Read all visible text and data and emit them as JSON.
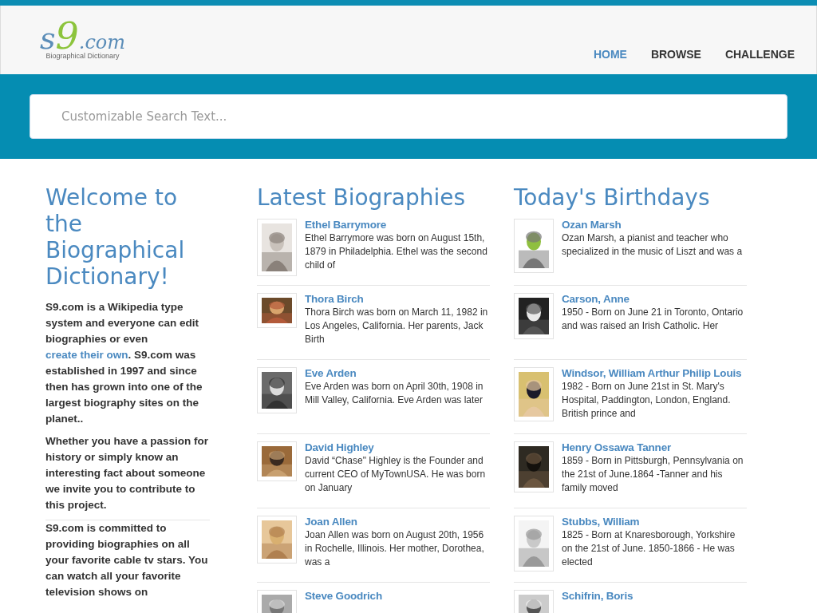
{
  "logo": {
    "letter": "s",
    "digit": "9",
    "suffix": ".com",
    "tagline": "Biographical Dictionary"
  },
  "nav": [
    {
      "label": "HOME",
      "selected": true
    },
    {
      "label": "BROWSE",
      "selected": false
    },
    {
      "label": "CHALLENGE",
      "selected": false
    }
  ],
  "search": {
    "placeholder": "Customizable Search Text..."
  },
  "welcome": {
    "title": "Welcome to the Biographical Dictionary!",
    "paragraphs": [
      [
        {
          "kind": "text",
          "text": "S9.com is a Wikipedia type system and everyone can edit biographies or even "
        },
        {
          "kind": "link",
          "text": "create their own"
        },
        {
          "kind": "text",
          "text": ". S9.com was established in 1997 and since then has grown into one of the largest biography sites on the planet.."
        }
      ],
      [
        {
          "kind": "text",
          "text": "Whether you have a passion for history or simply know an interesting fact about someone we invite you to contribute to this project."
        }
      ],
      [
        {
          "kind": "text",
          "text": "S9.com is committed to providing biographies on all your favorite cable tv stars. You can watch all your favorite television shows on"
        }
      ]
    ]
  },
  "latest": {
    "title": "Latest Biographies",
    "items": [
      {
        "name": "Ethel Barrymore",
        "summary": "Ethel Barrymore was born on August 15th, 1879 in Philadelphia. Ethel was the second child of"
      },
      {
        "name": "Thora Birch",
        "summary": "Thora Birch was born on March 11, 1982 in Los Angeles, California. Her parents, Jack Birth"
      },
      {
        "name": "Eve Arden",
        "summary": "Eve Arden was born on April 30th, 1908 in Mill Valley, California. Eve Arden was later"
      },
      {
        "name": "David Highley",
        "summary": "David “Chase\" Highley is the Founder and current CEO of MyTownUSA. He was born on January"
      },
      {
        "name": "Joan Allen",
        "summary": "Joan Allen was born on August 20th, 1956 in Rochelle, Illinois. Her mother, Dorothea, was a"
      },
      {
        "name": "Steve Goodrich"
      }
    ]
  },
  "birthdays": {
    "title": "Today's Birthdays",
    "items": [
      {
        "name": "Ozan Marsh",
        "summary": "Ozan Marsh, a pianist and teacher who specialized in the music of Liszt and was a"
      },
      {
        "name": "Carson, Anne",
        "summary": "1950 - Born on June 21 in Toronto, Ontario and was raised an Irish Catholic. Her"
      },
      {
        "name": "Windsor, William Arthur Philip Louis",
        "summary": "1982 - Born on June 21st in St. Mary's Hospital, Paddington, London, England. British prince and"
      },
      {
        "name": "Henry Ossawa Tanner",
        "summary": "1859 - Born in Pittsburgh, Pennsylvania on the 21st of June.1864 -Tanner and his family moved"
      },
      {
        "name": "Stubbs, William",
        "summary": "1825 - Born at Knaresborough, Yorkshire on the 21st of June. 1850-1866 - He was elected"
      },
      {
        "name": "Schifrin, Boris"
      }
    ]
  }
}
